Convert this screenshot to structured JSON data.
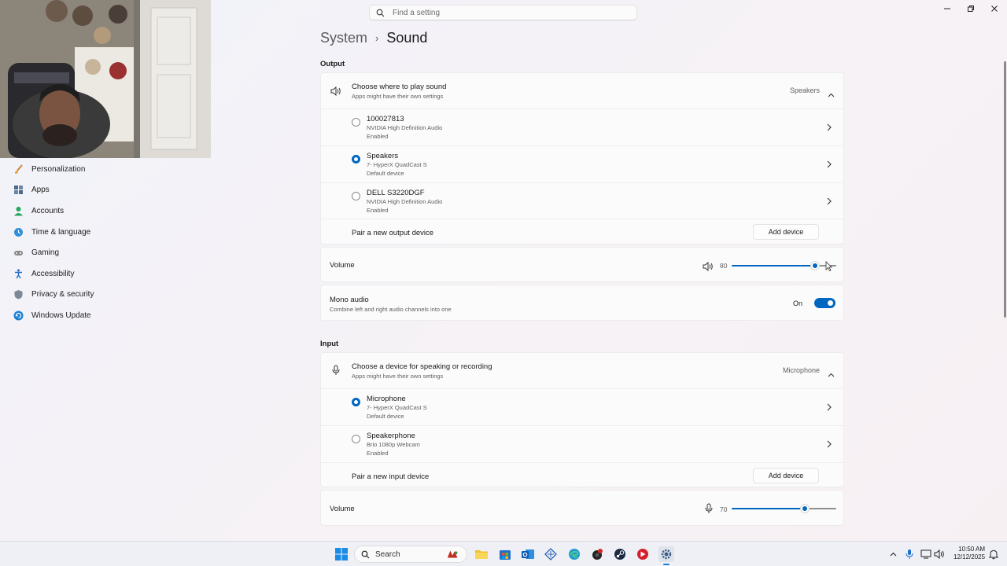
{
  "search": {
    "placeholder": "Find a setting"
  },
  "breadcrumb": {
    "parent": "System",
    "current": "Sound"
  },
  "sidebar": {
    "items": [
      {
        "label": "Personalization",
        "icon": "brush-icon"
      },
      {
        "label": "Apps",
        "icon": "apps-icon"
      },
      {
        "label": "Accounts",
        "icon": "person-icon"
      },
      {
        "label": "Time & language",
        "icon": "globe-clock-icon"
      },
      {
        "label": "Gaming",
        "icon": "gamepad-icon"
      },
      {
        "label": "Accessibility",
        "icon": "accessibility-icon"
      },
      {
        "label": "Privacy & security",
        "icon": "shield-icon"
      },
      {
        "label": "Windows Update",
        "icon": "update-icon"
      }
    ]
  },
  "output": {
    "heading": "Output",
    "choose_title": "Choose where to play sound",
    "choose_subtitle": "Apps might have their own settings",
    "selected": "Speakers",
    "devices": [
      {
        "name": "100027813",
        "detail": "NVIDIA High Definition Audio",
        "status": "Enabled",
        "selected": false
      },
      {
        "name": "Speakers",
        "detail": "7- HyperX QuadCast S",
        "status": "Default device",
        "selected": true
      },
      {
        "name": "DELL S3220DGF",
        "detail": "NVIDIA High Definition Audio",
        "status": "Enabled",
        "selected": false
      }
    ],
    "pair_label": "Pair a new output device",
    "add_button": "Add device",
    "volume_label": "Volume",
    "volume_value": "80",
    "volume_level": 0.8,
    "mono_title": "Mono audio",
    "mono_subtitle": "Combine left and right audio channels into one",
    "mono_state": "On"
  },
  "input": {
    "heading": "Input",
    "choose_title": "Choose a device for speaking or recording",
    "choose_subtitle": "Apps might have their own settings",
    "selected": "Microphone",
    "devices": [
      {
        "name": "Microphone",
        "detail": "7- HyperX QuadCast S",
        "status": "Default device",
        "selected": true
      },
      {
        "name": "Speakerphone",
        "detail": "Brio 1080p Webcam",
        "status": "Enabled",
        "selected": false
      }
    ],
    "pair_label": "Pair a new input device",
    "add_button": "Add device",
    "volume_label": "Volume",
    "volume_value": "70",
    "volume_level": 0.7
  },
  "taskbar": {
    "search_label": "Search",
    "time": "10:50 AM",
    "date": "12/12/2025"
  },
  "colors": {
    "accent": "#0067c0"
  }
}
